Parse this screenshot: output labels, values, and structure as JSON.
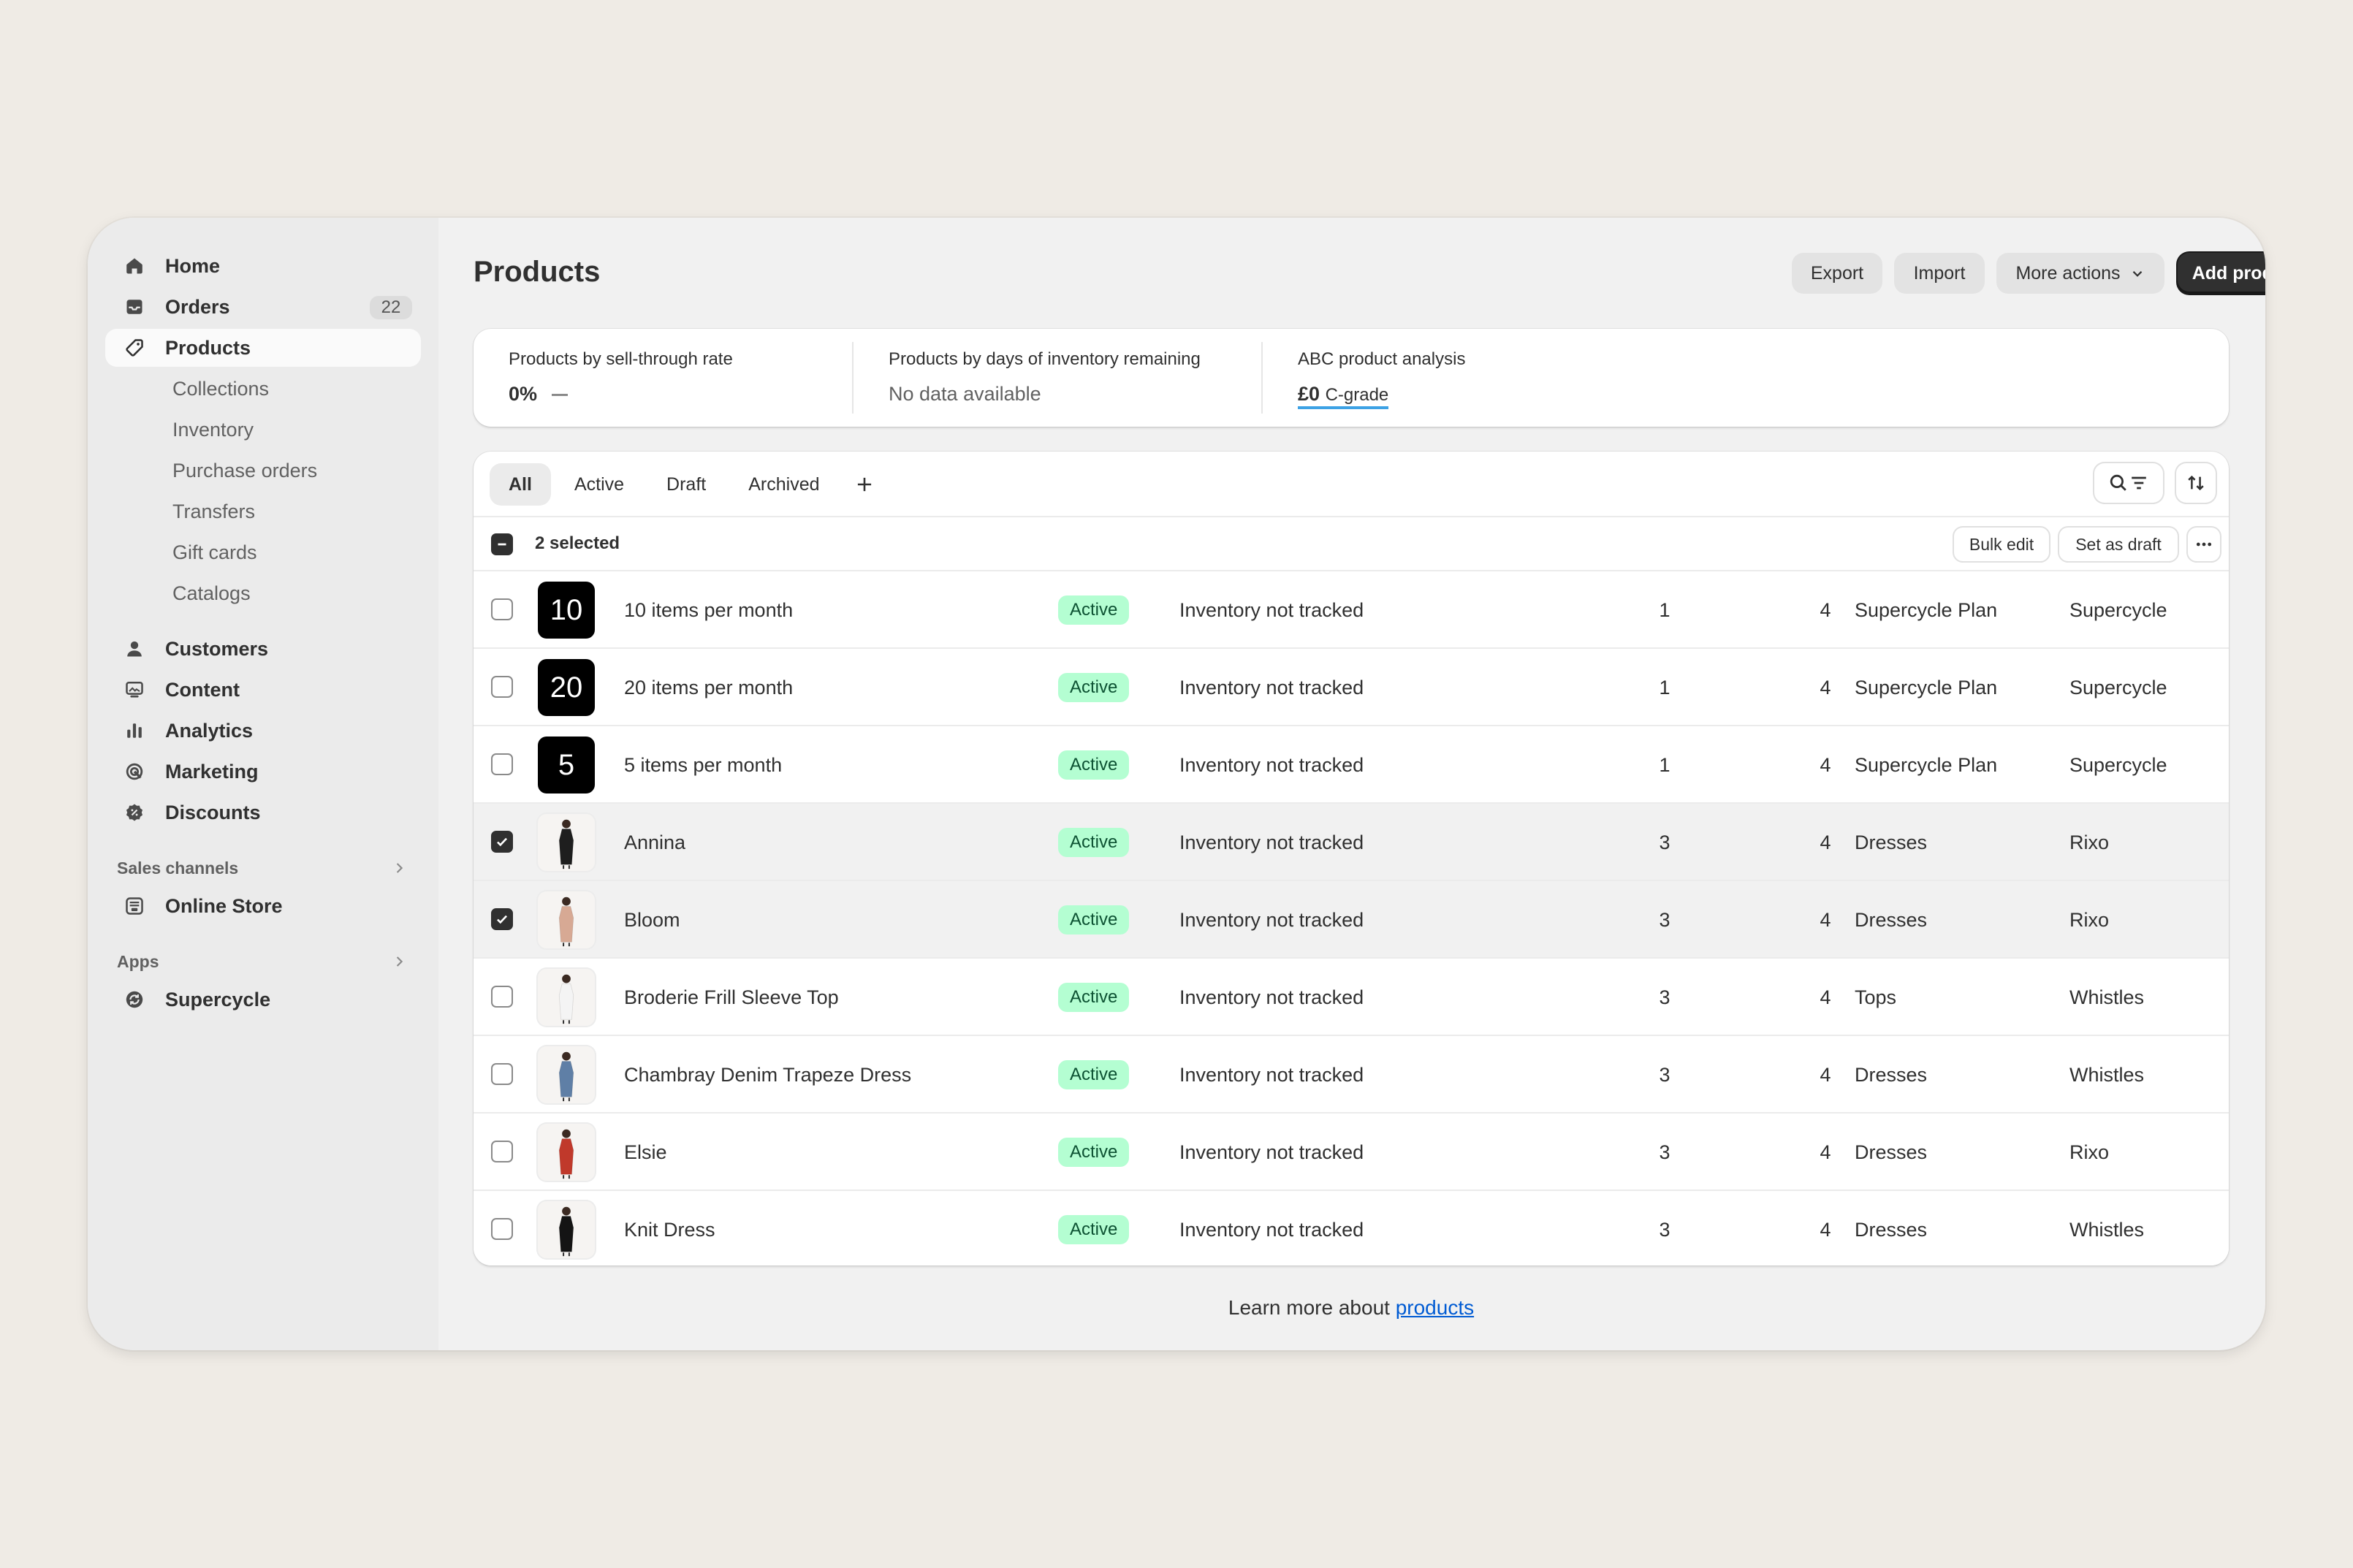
{
  "sidebar": {
    "main_items": [
      {
        "label": "Home",
        "icon": "home-icon"
      },
      {
        "label": "Orders",
        "icon": "inbox-icon",
        "count": "22"
      },
      {
        "label": "Products",
        "icon": "tag-icon"
      }
    ],
    "product_sub_items": [
      "Collections",
      "Inventory",
      "Purchase orders",
      "Transfers",
      "Gift cards",
      "Catalogs"
    ],
    "other_items": [
      {
        "label": "Customers",
        "icon": "person-icon"
      },
      {
        "label": "Content",
        "icon": "content-icon"
      },
      {
        "label": "Analytics",
        "icon": "bar-chart-icon"
      },
      {
        "label": "Marketing",
        "icon": "target-icon"
      },
      {
        "label": "Discounts",
        "icon": "discount-icon"
      }
    ],
    "sales_channels": {
      "title": "Sales channels",
      "items": [
        {
          "label": "Online Store",
          "icon": "store-icon"
        }
      ]
    },
    "apps": {
      "title": "Apps",
      "items": [
        {
          "label": "Supercycle",
          "icon": "supercycle-icon"
        }
      ]
    }
  },
  "header": {
    "title": "Products",
    "export_label": "Export",
    "import_label": "Import",
    "more_actions_label": "More actions",
    "add_product_label": "Add product"
  },
  "analytics": {
    "sell_through": {
      "label": "Products by sell-through rate",
      "value": "0%"
    },
    "days_inventory": {
      "label": "Products by days of inventory remaining",
      "value": "No data available"
    },
    "abc": {
      "label": "ABC product analysis",
      "value": "£0",
      "grade": "C-grade"
    }
  },
  "tabs": [
    "All",
    "Active",
    "Draft",
    "Archived"
  ],
  "selection": {
    "text": "2 selected",
    "bulk_edit_label": "Bulk edit",
    "set_draft_label": "Set as draft"
  },
  "products": [
    {
      "name": "10 items per month",
      "thumb_text": "10",
      "status": "Active",
      "inventory": "Inventory not tracked",
      "col_a": "1",
      "col_b": "4",
      "type": "Supercycle Plan",
      "vendor": "Supercycle",
      "checked": false
    },
    {
      "name": "20 items per month",
      "thumb_text": "20",
      "status": "Active",
      "inventory": "Inventory not tracked",
      "col_a": "1",
      "col_b": "4",
      "type": "Supercycle Plan",
      "vendor": "Supercycle",
      "checked": false
    },
    {
      "name": "5 items per month",
      "thumb_text": "5",
      "status": "Active",
      "inventory": "Inventory not tracked",
      "col_a": "1",
      "col_b": "4",
      "type": "Supercycle Plan",
      "vendor": "Supercycle",
      "checked": false
    },
    {
      "name": "Annina",
      "status": "Active",
      "inventory": "Inventory not tracked",
      "col_a": "3",
      "col_b": "4",
      "type": "Dresses",
      "vendor": "Rixo",
      "checked": true,
      "photo_color": "#1e1e1e"
    },
    {
      "name": "Bloom",
      "status": "Active",
      "inventory": "Inventory not tracked",
      "col_a": "3",
      "col_b": "4",
      "type": "Dresses",
      "vendor": "Rixo",
      "checked": true,
      "photo_color": "#d7a994"
    },
    {
      "name": "Broderie Frill Sleeve Top",
      "status": "Active",
      "inventory": "Inventory not tracked",
      "col_a": "3",
      "col_b": "4",
      "type": "Tops",
      "vendor": "Whistles",
      "checked": false,
      "photo_color": "#f4f4f4"
    },
    {
      "name": "Chambray Denim Trapeze Dress",
      "status": "Active",
      "inventory": "Inventory not tracked",
      "col_a": "3",
      "col_b": "4",
      "type": "Dresses",
      "vendor": "Whistles",
      "checked": false,
      "photo_color": "#5f7fa6"
    },
    {
      "name": "Elsie",
      "status": "Active",
      "inventory": "Inventory not tracked",
      "col_a": "3",
      "col_b": "4",
      "type": "Dresses",
      "vendor": "Rixo",
      "checked": false,
      "photo_color": "#c0392b"
    },
    {
      "name": "Knit Dress",
      "status": "Active",
      "inventory": "Inventory not tracked",
      "col_a": "3",
      "col_b": "4",
      "type": "Dresses",
      "vendor": "Whistles",
      "checked": false,
      "photo_color": "#141414"
    }
  ],
  "footer": {
    "text": "Learn more about ",
    "link": "products"
  },
  "colors": {
    "status_bg": "#b4fed2",
    "status_text": "#0c5132",
    "link": "#005bd3",
    "primary": "#303030"
  }
}
